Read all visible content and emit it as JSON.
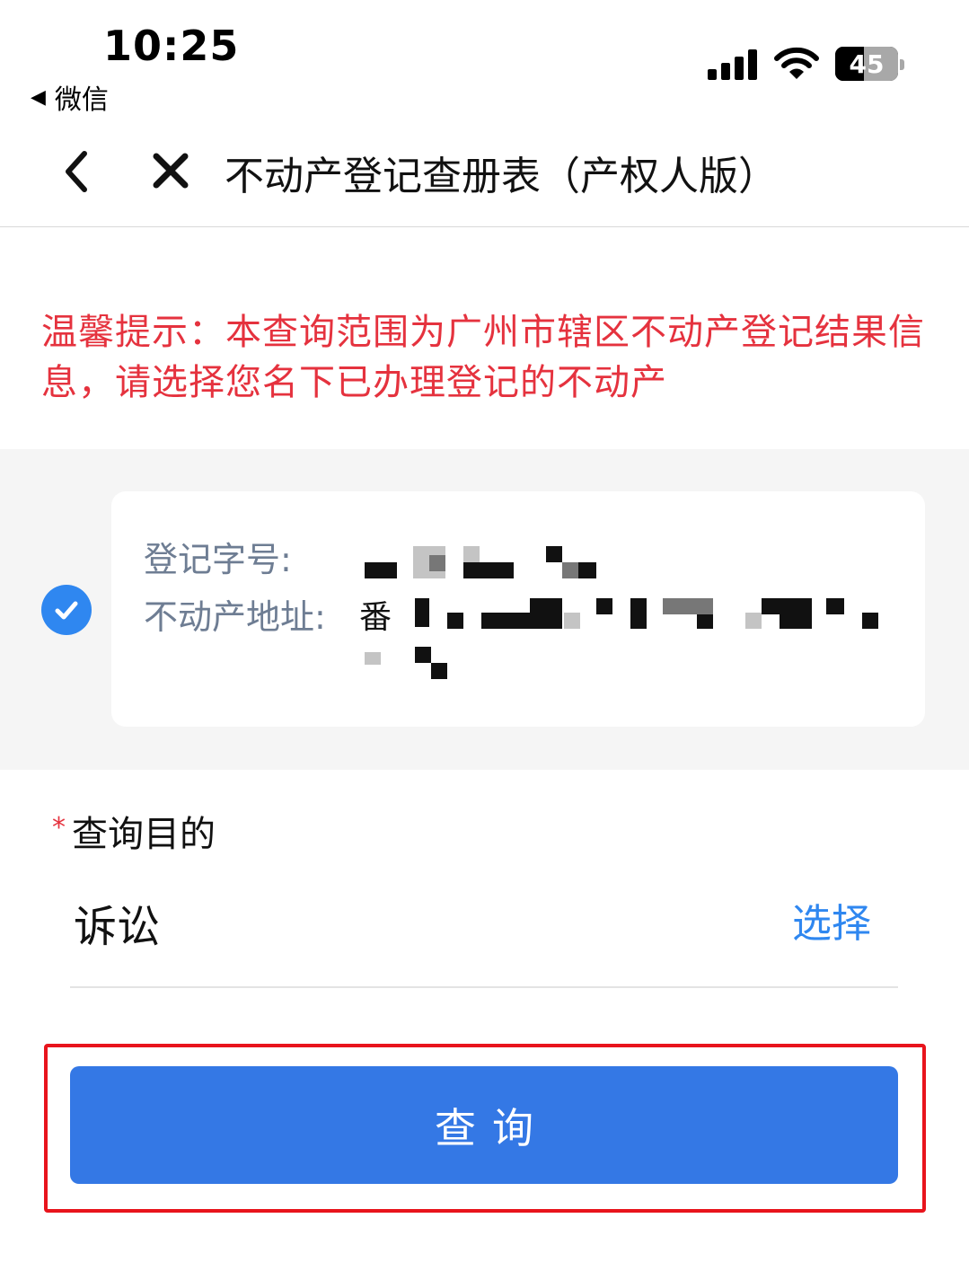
{
  "status_bar": {
    "time": "10:25",
    "back_app_label": "微信",
    "battery_level": "45"
  },
  "nav": {
    "title": "不动产登记查册表（产权人版）"
  },
  "tip": {
    "text": "温馨提示：本查询范围为广州市辖区不动产登记结果信息，请选择您名下已办理登记的不动产"
  },
  "property": {
    "reg_no_label": "登记字号:",
    "address_label": "不动产地址:",
    "address_value_visible": "番"
  },
  "purpose": {
    "required_mark": "*",
    "label": "查询目的",
    "value": "诉讼",
    "select_label": "选择"
  },
  "actions": {
    "query_label": "查询"
  },
  "colors": {
    "accent_blue": "#3478e5",
    "alert_red": "#e5323e",
    "highlight_red": "#e8141c"
  }
}
